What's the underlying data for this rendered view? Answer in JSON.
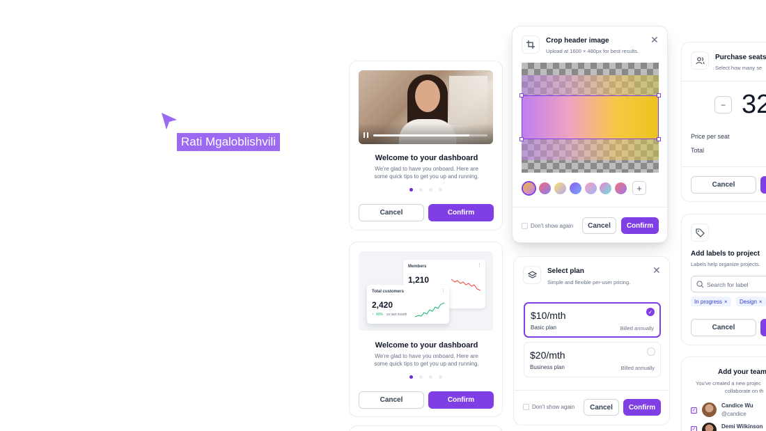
{
  "cursor": {
    "name": "Rati Mgaloblishvili",
    "color": "#9b6af0"
  },
  "onboard_video": {
    "title": "Welcome to your dashboard",
    "subtitle_1": "We're glad to have you onboard. Here are",
    "subtitle_2": "some quick tips to get you up and running.",
    "cancel": "Cancel",
    "confirm": "Confirm"
  },
  "onboard_chart": {
    "members_label": "Members",
    "members_value": "1,210",
    "customers_label": "Total customers",
    "customers_value": "2,420",
    "customers_change": "40%",
    "customers_change_note": "vs last month",
    "title": "Welcome to your dashboard",
    "subtitle_1": "We're glad to have you onboard. Here are",
    "subtitle_2": "some quick tips to get you up and running.",
    "cancel": "Cancel",
    "confirm": "Confirm"
  },
  "crop": {
    "title": "Crop header image",
    "subtitle": "Upload at 1600 × 480px for best results.",
    "dont_show": "Don't show again",
    "cancel": "Cancel",
    "confirm": "Confirm",
    "add_symbol": "+"
  },
  "plan": {
    "title": "Select plan",
    "subtitle": "Simple and flexible per-user pricing.",
    "options": [
      {
        "price": "$10/mth",
        "name": "Basic plan",
        "billing": "Billed annually",
        "selected": true
      },
      {
        "price": "$20/mth",
        "name": "Business plan",
        "billing": "Billed annually",
        "selected": false
      }
    ],
    "dont_show": "Don't show again",
    "cancel": "Cancel",
    "confirm": "Confirm"
  },
  "seats": {
    "title": "Purchase seats",
    "subtitle": "Select how many se",
    "minus": "−",
    "count": "32",
    "price_label": "Price per seat",
    "total_label": "Total",
    "cancel": "Cancel"
  },
  "labels": {
    "title": "Add labels to project",
    "subtitle": "Labels help organize projects.",
    "search_placeholder": "Search for label",
    "tags": [
      "In progress",
      "Design"
    ],
    "cancel": "Cancel"
  },
  "team": {
    "title": "Add your team",
    "subtitle_1": "You've created a new projec",
    "subtitle_2": "collaborate on th",
    "members": [
      {
        "name": "Candice Wu",
        "handle": "@candice"
      },
      {
        "name": "Demi Wilkinson",
        "handle": ""
      }
    ]
  },
  "colors": {
    "primary": "#7f3fe4",
    "border": "#eaecf0",
    "text": "#101828",
    "muted": "#667085"
  }
}
